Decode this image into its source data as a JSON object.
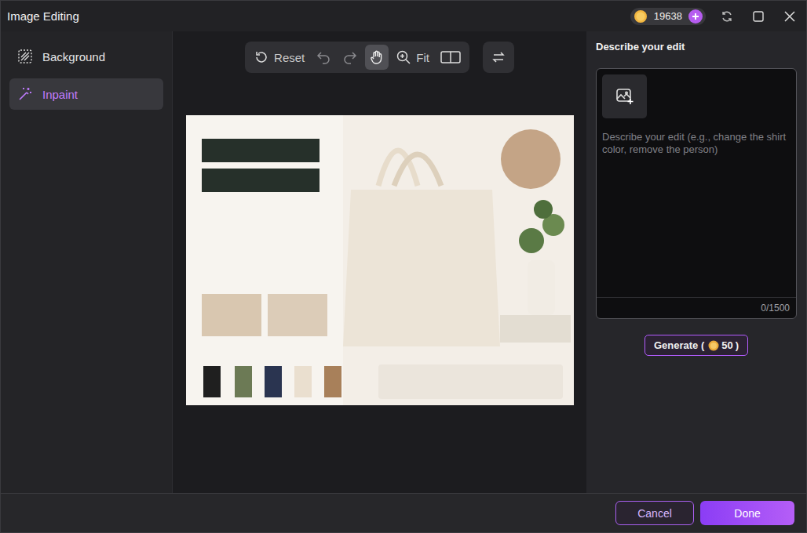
{
  "window": {
    "title": "Image Editing",
    "credits": "19638"
  },
  "sidebar": {
    "items": [
      {
        "label": "Background",
        "selected": false
      },
      {
        "label": "Inpaint",
        "selected": true
      }
    ]
  },
  "toolbar": {
    "reset": "Reset",
    "fit": "Fit",
    "undo": {
      "disabled": true
    },
    "redo": {
      "disabled": true
    },
    "pan": {
      "selected": true
    }
  },
  "panel": {
    "title": "Describe your edit",
    "placeholder": "Describe your edit (e.g., change the shirt color, remove the person)",
    "counter": "0/1500",
    "generate": {
      "label": "Generate (",
      "cost": "50",
      "close": ")"
    }
  },
  "footer": {
    "buttons": [
      {
        "label": "Cancel",
        "primary": false
      },
      {
        "label": "Done",
        "primary": true
      }
    ]
  }
}
